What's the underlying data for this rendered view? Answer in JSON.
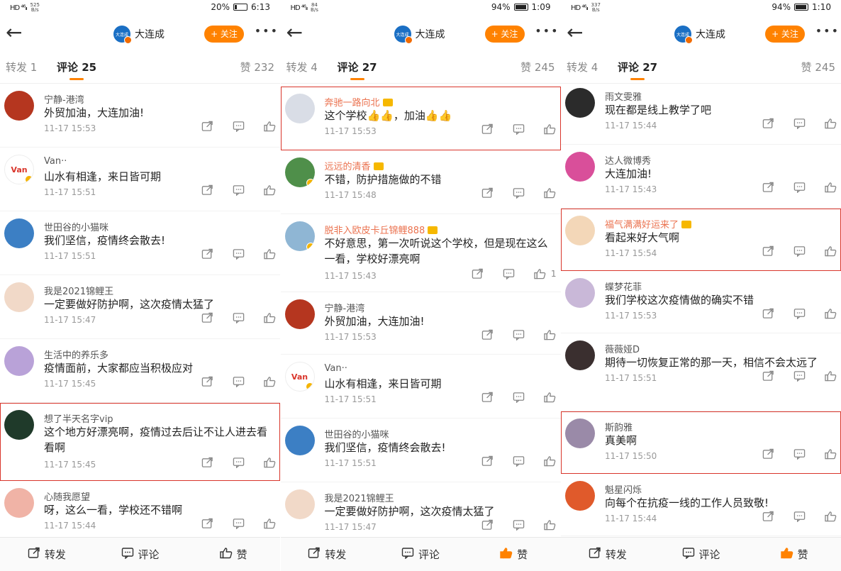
{
  "common": {
    "account_name": "大连成",
    "account_avatar_text": "大连成",
    "follow_label": "+ 关注",
    "more_label": "•••",
    "bottom": {
      "repost_label": "转发",
      "comment_label": "评论",
      "like_label": "赞"
    },
    "colors": {
      "accent": "#ff8200",
      "highlight_box": "#d9352b",
      "vip_name": "#eb7350"
    }
  },
  "panels": [
    {
      "status": {
        "left_icons": "HD ⁴⁶ᵢₗₗ",
        "speed_top": "525",
        "speed_bottom": "B/s",
        "battery": "20%",
        "time": "6:13"
      },
      "tabs": {
        "repost": "转发 1",
        "comment": "评论 25",
        "likes": "赞 232"
      },
      "liked": false,
      "comments": [
        {
          "name": "宁静-港湾",
          "text": "外贸加油，大连加油!",
          "time": "11-17 15:53",
          "avatar_color": "#b5361f",
          "avatar_text": ""
        },
        {
          "name": "Van··",
          "text": "山水有相逢，来日皆可期",
          "time": "11-17 15:51",
          "avatar_color": "#ffffff",
          "avatar_text": "Van",
          "verified": true
        },
        {
          "name": "世田谷的小猫咪",
          "text": "我们坚信，疫情终会散去!",
          "time": "11-17 15:51",
          "avatar_color": "#3c7fc4",
          "avatar_text": ""
        },
        {
          "name": "我是2021锦鲤王",
          "text": "一定要做好防护啊，这次疫情太猛了",
          "time": "11-17 15:47",
          "avatar_color": "#f1d9c8",
          "avatar_text": ""
        },
        {
          "name": "生活中的养乐多",
          "text": "疫情面前，大家都应当积极应对",
          "time": "11-17 15:45",
          "avatar_color": "#b9a2d8",
          "avatar_text": ""
        },
        {
          "name": "想了半天名字vip",
          "text": "这个地方好漂亮啊，疫情过去后让不让人进去看看啊",
          "time": "11-17 15:45",
          "avatar_color": "#1f3a2a",
          "avatar_text": "",
          "highlight": true
        },
        {
          "name": "心随我愿望",
          "text": "呀，这么一看，学校还不错啊",
          "time": "11-17 15:44",
          "avatar_color": "#f0b3a6",
          "avatar_text": ""
        }
      ]
    },
    {
      "status": {
        "left_icons": "HD ⁴⁶ᵢₗₗ",
        "speed_top": "84",
        "speed_bottom": "B/s",
        "battery": "94%",
        "time": "1:09"
      },
      "tabs": {
        "repost": "转发 4",
        "comment": "评论 27",
        "likes": "赞 245"
      },
      "liked": true,
      "comments": [
        {
          "name": "奔驰一路向北",
          "text": "这个学校👍👍，加油👍👍",
          "time": "11-17 15:53",
          "avatar_color": "#d9dde6",
          "avatar_text": "",
          "highlight": true,
          "vip": true
        },
        {
          "name": "远远的清香",
          "text": "不错，防护措施做的不错",
          "time": "11-17 15:48",
          "avatar_color": "#4f8f4a",
          "avatar_text": "",
          "vip": true,
          "verified": true
        },
        {
          "name": "脱非入欧皮卡丘锦鲤888",
          "text": "不好意思，第一次听说这个学校，但是现在这么一看，学校好漂亮啊",
          "time": "11-17 15:43",
          "avatar_color": "#8fb6d4",
          "avatar_text": "",
          "vip": true,
          "verified": true,
          "like_count": "1"
        },
        {
          "name": "宁静-港湾",
          "text": "外贸加油，大连加油!",
          "time": "11-17 15:53",
          "avatar_color": "#b5361f",
          "avatar_text": ""
        },
        {
          "name": "Van··",
          "text": "山水有相逢，来日皆可期",
          "time": "11-17 15:51",
          "avatar_color": "#ffffff",
          "avatar_text": "Van",
          "verified": true
        },
        {
          "name": "世田谷的小猫咪",
          "text": "我们坚信，疫情终会散去!",
          "time": "11-17 15:51",
          "avatar_color": "#3c7fc4",
          "avatar_text": ""
        },
        {
          "name": "我是2021锦鲤王",
          "text": "一定要做好防护啊，这次疫情太猛了",
          "time": "11-17 15:47",
          "avatar_color": "#f1d9c8",
          "avatar_text": ""
        }
      ]
    },
    {
      "status": {
        "left_icons": "HD ⁴⁶ᵢₗₗ",
        "speed_top": "337",
        "speed_bottom": "B/s",
        "battery": "94%",
        "time": "1:10"
      },
      "tabs": {
        "repost": "转发 4",
        "comment": "评论 27",
        "likes": "赞 245"
      },
      "liked": true,
      "comments": [
        {
          "name": "雨文雯雅",
          "text": "现在都是线上教学了吧",
          "time": "11-17 15:44",
          "avatar_color": "#2b2b2b",
          "avatar_text": ""
        },
        {
          "name": "达人微博秀",
          "text": "大连加油!",
          "time": "11-17 15:43",
          "avatar_color": "#d94f9a",
          "avatar_text": ""
        },
        {
          "name": "福气满满好运来了",
          "text": "看起来好大气啊",
          "time": "11-17 15:54",
          "avatar_color": "#f3d7b8",
          "avatar_text": "",
          "highlight": true,
          "vip": true
        },
        {
          "name": "蝶梦花菲",
          "text": "我们学校这次疫情做的确实不错",
          "time": "11-17 15:53",
          "avatar_color": "#c9b8d8",
          "avatar_text": ""
        },
        {
          "name": "薇薇娅D",
          "text": "期待一切恢复正常的那一天，相信不会太远了",
          "time": "11-17 15:51",
          "avatar_color": "#3a2f2f",
          "avatar_text": ""
        },
        {
          "name": "斯韵雅",
          "text": "真美啊",
          "time": "11-17 15:50",
          "avatar_color": "#9a8aa8",
          "avatar_text": "",
          "highlight": true
        },
        {
          "name": "魁星闪烁",
          "text": "向每个在抗疫一线的工作人员致敬!",
          "time": "11-17 15:44",
          "avatar_color": "#e05a2b",
          "avatar_text": ""
        }
      ]
    }
  ]
}
